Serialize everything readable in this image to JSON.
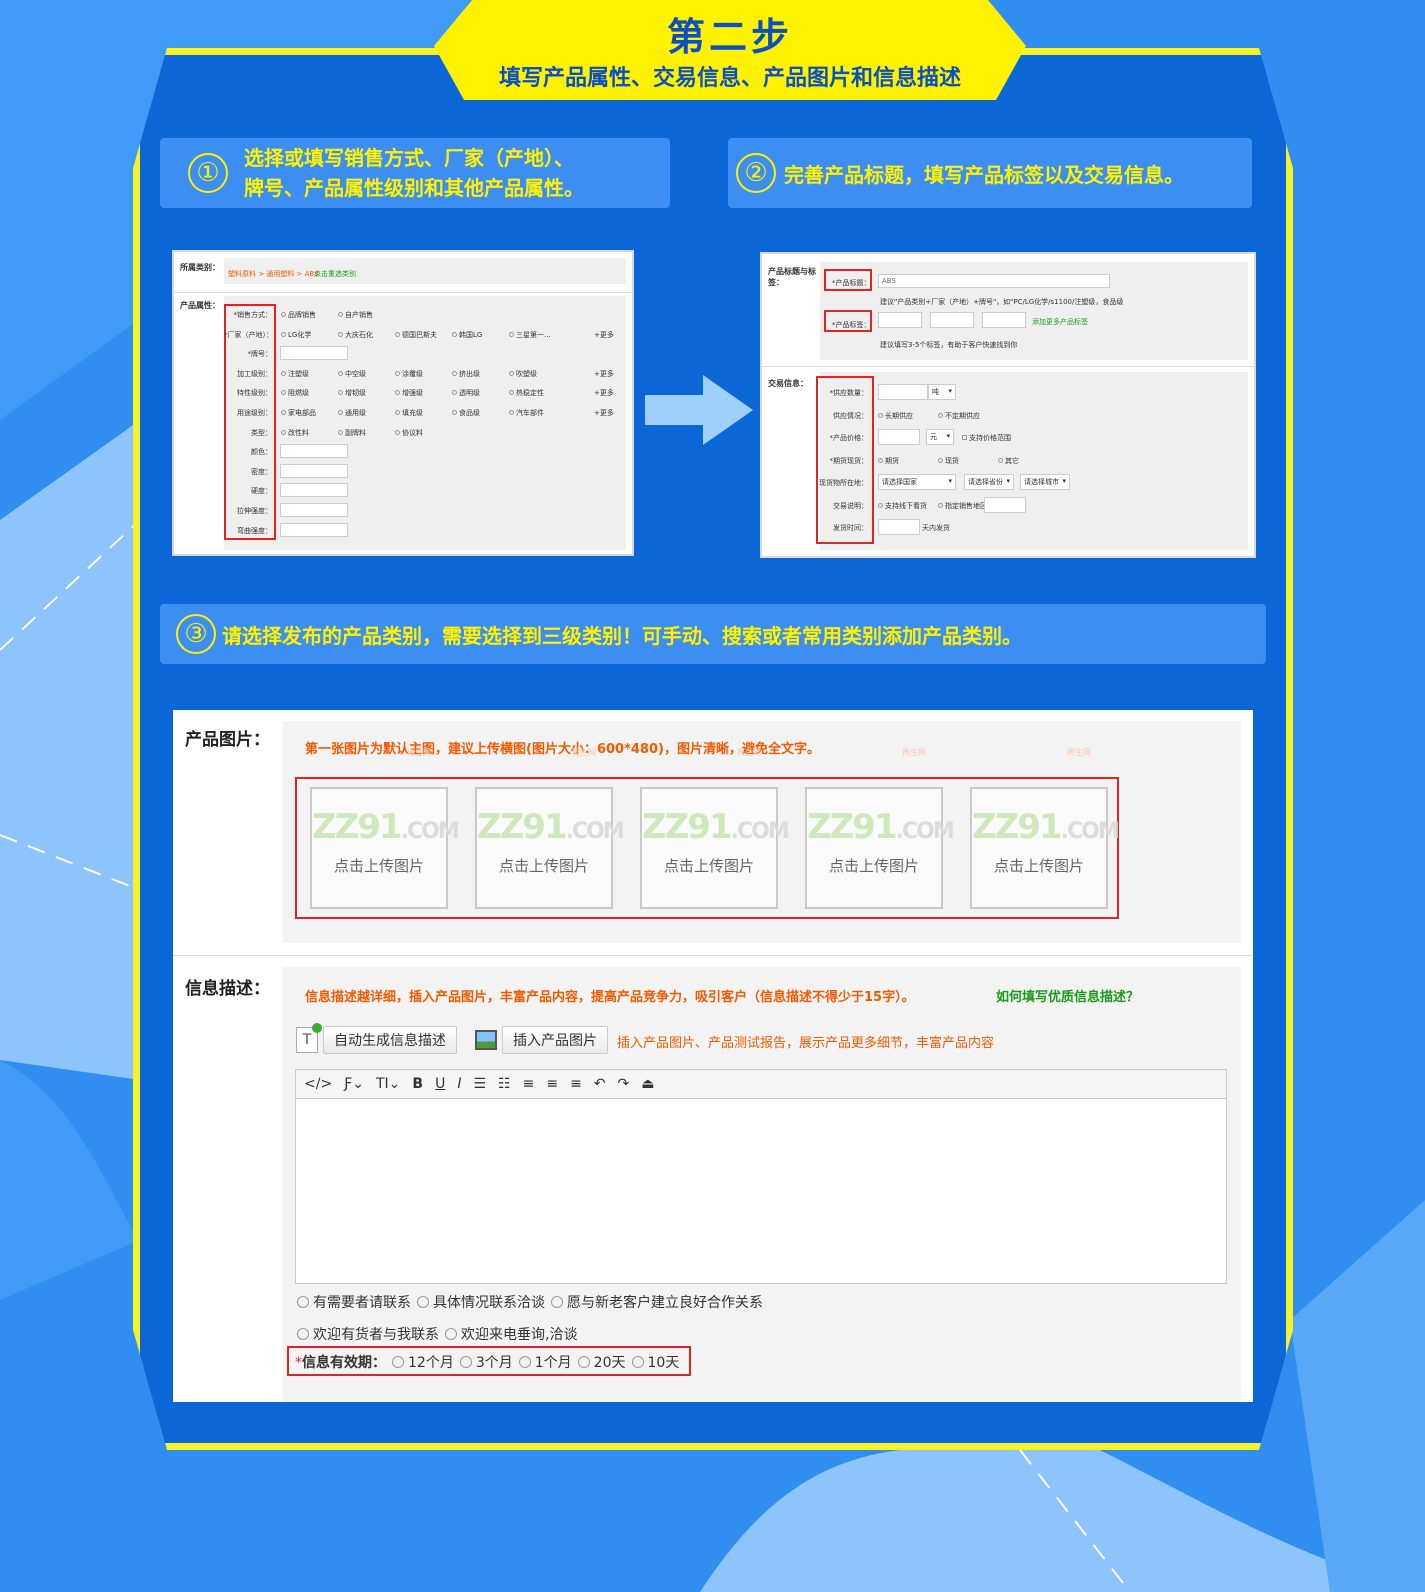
{
  "header": {
    "title": "第二步",
    "subtitle": "填写产品属性、交易信息、产品图片和信息描述"
  },
  "steps": [
    {
      "num": "①",
      "text_line1": "选择或填写销售方式、厂家（产地）、",
      "text_line2": "牌号、产品属性级别和其他产品属性。"
    },
    {
      "num": "②",
      "text": "完善产品标题，填写产品标签以及交易信息。"
    },
    {
      "num": "③",
      "text": "请选择发布的产品类别，需要选择到三级类别！可手动、搜索或者常用类别添加产品类别。"
    }
  ],
  "shot1": {
    "category_label": "所属类别：",
    "breadcrumb": "塑料原料 > 通用塑料 > ABS",
    "reselect": "点击重选类别",
    "attr_label": "产品属性：",
    "rows": [
      {
        "label": "*销售方式：",
        "opts": [
          "品牌销售",
          "自产销售"
        ]
      },
      {
        "label": "*厂家（产地）：",
        "opts": [
          "LG化学",
          "大庆石化",
          "德国巴斯夫",
          "韩国LG",
          "三星第一..."
        ],
        "more": "+更多"
      },
      {
        "label": "*牌号：",
        "field": true
      },
      {
        "label": "加工级别：",
        "opts": [
          "注塑级",
          "中空级",
          "涂覆级",
          "挤出级",
          "吹塑级"
        ],
        "more": "+更多"
      },
      {
        "label": "特性级别：",
        "opts": [
          "阻燃级",
          "增韧级",
          "增强级",
          "透明级",
          "热稳定性"
        ],
        "more": "+更多"
      },
      {
        "label": "用途级别：",
        "opts": [
          "家电部品",
          "通用级",
          "填充级",
          "食品级",
          "汽车部件"
        ],
        "more": "+更多"
      },
      {
        "label": "类型：",
        "opts": [
          "改性料",
          "副牌料",
          "协议料"
        ]
      },
      {
        "label": "颜色：",
        "field": true
      },
      {
        "label": "密度：",
        "field": true
      },
      {
        "label": "硬度：",
        "field": true
      },
      {
        "label": "拉伸强度：",
        "field": true
      },
      {
        "label": "弯曲强度：",
        "field": true
      }
    ]
  },
  "shot2": {
    "title_label": "产品标题与标签：",
    "product_title": "*产品标题：",
    "title_value": "ABS",
    "title_hint": "建议\"产品类别+厂家（产地）+牌号\"，如\"PC/LG化学/s1100/注塑级，食品级",
    "product_tag": "*产品标签：",
    "add_tag": "添加更多产品标签",
    "tag_hint": "建议填写3-5个标签，有助于客户快速找到你",
    "trade_label": "交易信息：",
    "supply_qty": "*供应数量：",
    "unit": "吨",
    "supply_status": "供应情况：",
    "supply_opts": [
      "长期供应",
      "不定期供应"
    ],
    "price": "*产品价格：",
    "currency": "元",
    "price_range": "支持价格范围",
    "spot": "*期货现货：",
    "spot_opts": [
      "期货",
      "现货",
      "其它"
    ],
    "location": "现货物所在地：",
    "loc_opts": [
      "请选择国家",
      "请选择省份",
      "请选择城市"
    ],
    "trade_desc": "交易说明：",
    "trade_opts": [
      "支持线下看货",
      "指定销售地区"
    ],
    "ship": "发货时间：",
    "ship_unit": "天内发货"
  },
  "images": {
    "label": "产品图片：",
    "hint": "第一张图片为默认主图，建议上传横图(图片大小：600*480)，图片清晰，避免全文字。",
    "logo_main": "ZZ91",
    "logo_suffix": ".COM",
    "logo_tag": "再生网",
    "slots": [
      "点击上传图片",
      "点击上传图片",
      "点击上传图片",
      "点击上传图片",
      "点击上传图片"
    ]
  },
  "desc": {
    "label": "信息描述：",
    "hint": "信息描述越详细，插入产品图片，丰富产品内容，提高产品竞争力，吸引客户（信息描述不得少于15字）。",
    "howto": "如何填写优质信息描述？",
    "auto_btn": "自动生成信息描述",
    "insert_btn": "插入产品图片",
    "insert_hint": "插入产品图片、产品测试报告，展示产品更多细节，丰富产品内容",
    "toolbar": [
      "</>",
      "Ƒ⌄",
      "TI⌄",
      "B",
      "U",
      "I",
      "☰",
      "☷",
      "≡",
      "≡",
      "≡",
      "↶",
      "↷",
      "⏏"
    ],
    "phrases1": [
      "有需要者请联系",
      "具体情况联系洽谈",
      "愿与新老客户建立良好合作关系"
    ],
    "phrases2": [
      "欢迎有货者与我联系",
      "欢迎来电垂询,洽谈"
    ],
    "validity_label": "信息有效期：",
    "validity": [
      "12个月",
      "3个月",
      "1个月",
      "20天",
      "10天"
    ]
  },
  "colors": {
    "bg": "#2f8ef0",
    "frame": "#0b67d8",
    "yellow": "#fff200",
    "accent_red": "#e02424",
    "orange": "#f25a00",
    "green": "#1a9a1a"
  }
}
